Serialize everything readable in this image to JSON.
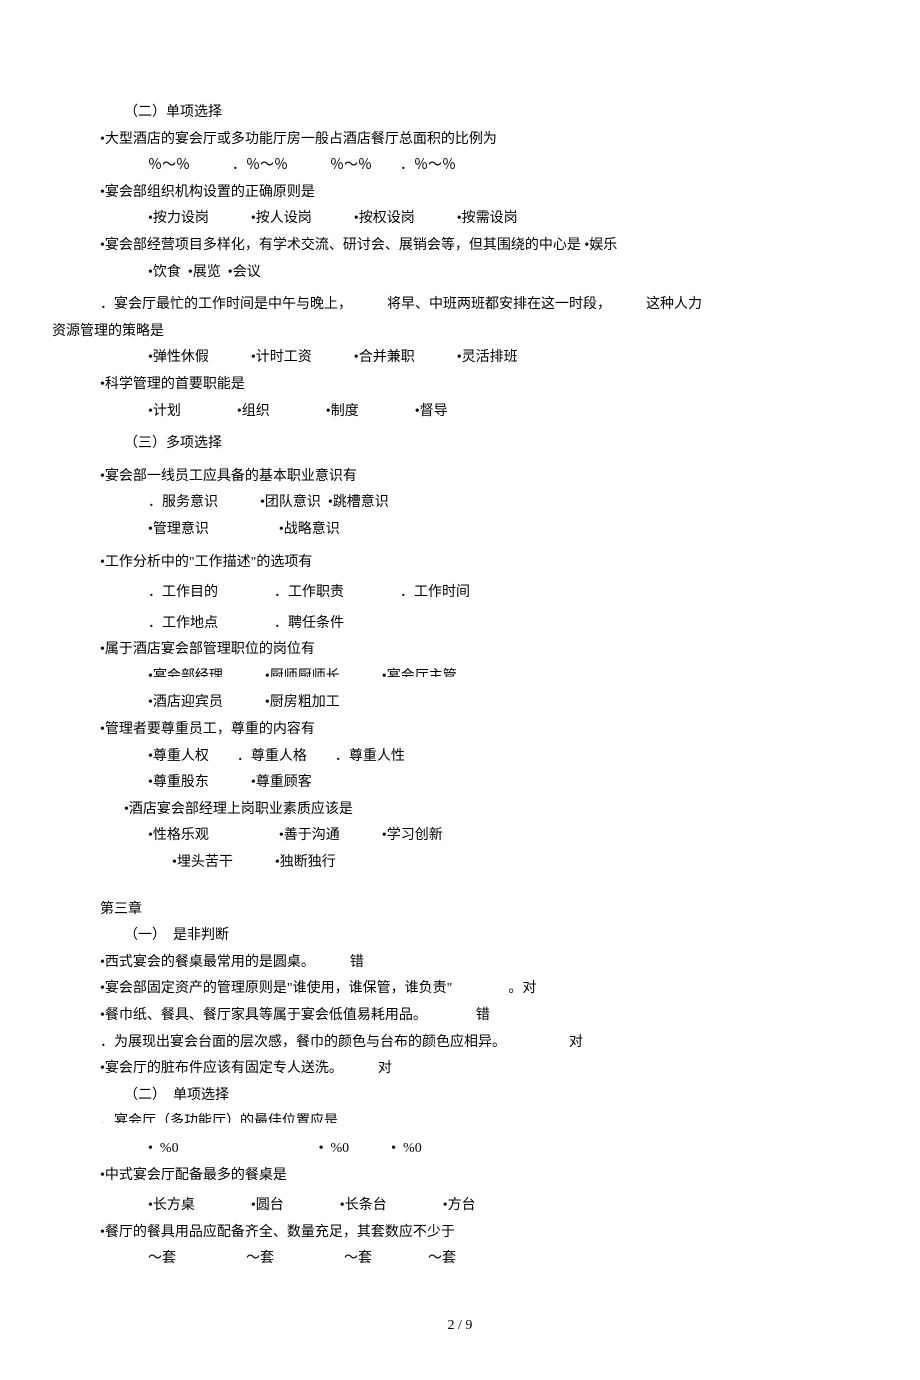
{
  "sec2": {
    "heading": "（二）单项选择",
    "q1": {
      "stem": "•大型酒店的宴会厅或多功能厅房一般占酒店餐厅总面积的比例为",
      "opts": "％～％　　　．％～％　　　％～％　　．％～％"
    },
    "q2": {
      "stem": "•宴会部组织机构设置的正确原则是",
      "opts": "•按力设岗　　　•按人设岗　　　•按权设岗　　　•按需设岗"
    },
    "q3": {
      "stem1": "•宴会部经营项目多样化，有学术交流、研讨会、展销会等，但其围绕的中心是 •娱乐",
      "stem2": "•饮食  •展览  •会议"
    },
    "q4": {
      "stem1": "．宴会厅最忙的工作时间是中午与晚上，　　　将早、中班两班都安排在这一时段，　　　这种人力",
      "stem2": "资源管理的策略是",
      "opts": "•弹性休假　　　•计时工资　　　•合并兼职　　　•灵活排班"
    },
    "q5": {
      "stem": "•科学管理的首要职能是",
      "opts": "•计划　　　　•组织　　　　•制度　　　　•督导"
    }
  },
  "sec3": {
    "heading": "（三）多项选择",
    "q1": {
      "stem": "•宴会部一线员工应具备的基本职业意识有",
      "opts1": "．服务意识　　　•团队意识  •跳槽意识",
      "opts2": "•管理意识　　　　　•战略意识"
    },
    "q2": {
      "stem": "•工作分析中的\"工作描述\"的选项有",
      "opts1": "．工作目的　　　　．工作职责　　　　．工作时间",
      "opts2": "．工作地点　　　　．聘任条件"
    },
    "q3": {
      "stem": "•属于酒店宴会部管理职位的岗位有",
      "opts1": "•宴会部经理　　　•厨师厨师长　　　•宴会厅主管",
      "opts2": "•酒店迎宾员　　　•厨房粗加工"
    },
    "q4": {
      "stem": "•管理者要尊重员工，尊重的内容有",
      "opts1": "•尊重人权　　．尊重人格　　．尊重人性",
      "opts2": "•尊重股东　　　•尊重顾客"
    },
    "q5": {
      "stem": "•酒店宴会部经理上岗职业素质应该是",
      "opts1": "•性格乐观　　　　　•善于沟通　　　•学习创新",
      "opts2": "•埋头苦干　　　•独断独行"
    }
  },
  "ch3": {
    "title": "第三章",
    "sec1": {
      "heading": "（一）　是非判断",
      "q1": "•西式宴会的餐桌最常用的是圆桌。　　　错",
      "q2": "•宴会部固定资产的管理原则是\"谁使用，谁保管，谁负责\"　　　　。对",
      "q3": "•餐巾纸、餐具、餐厅家具等属于宴会低值易耗用品。　　　　错",
      "q4": "．为展现出宴会台面的层次感，餐巾的颜色与台布的颜色应相异。　　　　　对",
      "q5": "•宴会厅的脏布件应该有固定专人送洗。　　　对"
    },
    "sec2": {
      "heading": "（二）　单项选择",
      "q1": {
        "stem": "．宴会厅（多功能厅）的最佳位置应是",
        "opts": "•  %0　　　　　　　　　　•  %0　　　•  %0"
      },
      "q2": {
        "stem": "•中式宴会厅配备最多的餐桌是",
        "opts": "•长方桌　　　　•圆台　　　　•长条台　　　　•方台"
      },
      "q3": {
        "stem": "•餐厅的餐具用品应配备齐全、数量充足，其套数应不少于",
        "opts": "～套　　　　　～套　　　　　～套　　　　～套"
      }
    }
  },
  "pageNum": "2 / 9"
}
